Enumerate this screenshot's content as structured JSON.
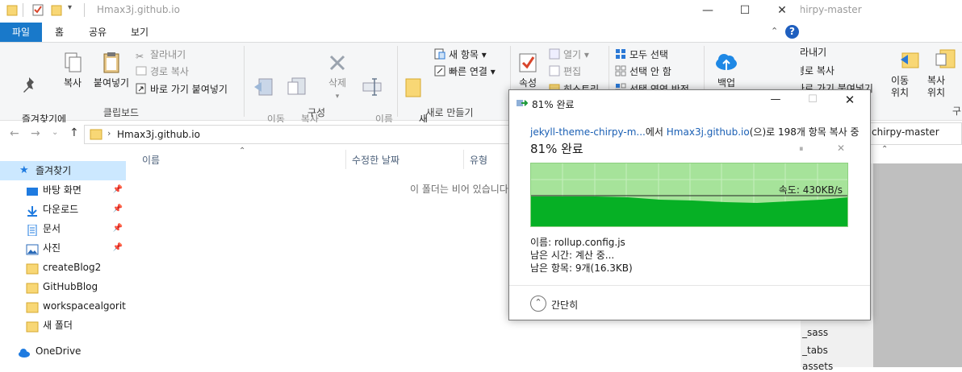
{
  "explorer": {
    "window_title": "Hmax3j.github.io",
    "tabs": [
      "파일",
      "홈",
      "공유",
      "보기"
    ],
    "ribbon": {
      "clipboard": {
        "pin": "즐겨찾기에\n고정",
        "copy": "복사",
        "paste": "붙여넣기",
        "cut": "잘라내기",
        "copy_path": "경로 복사",
        "paste_shortcut": "바로 가기 붙여넣기",
        "label": "클립보드"
      },
      "organize": {
        "move": "이동\n위치",
        "copy_to": "복사\n위치",
        "delete": "삭제",
        "rename": "이름\n바꾸기",
        "label": "구성"
      },
      "new": {
        "new_folder": "새\n폴더",
        "new_item": "새 항목",
        "easy_access": "빠른 연결",
        "label": "새로 만들기"
      },
      "open": {
        "properties": "속성",
        "open": "열기",
        "edit": "편집",
        "history": "히스토리"
      },
      "select": {
        "select_all": "모두 선택",
        "select_none": "선택 안 함",
        "invert": "선택 영역 반전"
      },
      "backup": "백업"
    },
    "address": {
      "path_item": "Hmax3j.github.io"
    },
    "nav": {
      "quick_access": "즐겨찾기",
      "items": [
        {
          "label": "바탕 화면",
          "pinned": true
        },
        {
          "label": "다운로드",
          "pinned": true
        },
        {
          "label": "문서",
          "pinned": true
        },
        {
          "label": "사진",
          "pinned": true
        },
        {
          "label": "createBlog2",
          "pinned": false
        },
        {
          "label": "GitHubBlog",
          "pinned": false
        },
        {
          "label": "workspacealgorithm",
          "pinned": false
        },
        {
          "label": "새 폴더",
          "pinned": false
        }
      ],
      "onedrive": "OneDrive"
    },
    "columns": [
      "이름",
      "수정한 날짜",
      "유형"
    ],
    "empty_message": "이 폴더는 비어 있습니다."
  },
  "right_window": {
    "title": "chirpy-master",
    "copy_path": "경로 복사",
    "paste_shortcut": "바로 가기 붙여넣기",
    "move": "이동\n위치",
    "copy_to": "복사\n위치",
    "group_label_partial": "구",
    "address": "chirpy-master",
    "files": [
      "_sass",
      "_tabs",
      "assets"
    ]
  },
  "dialog": {
    "title": "81% 완료",
    "src_link": "jekyll-theme-chirpy-m...",
    "from_text": "에서 ",
    "dst_link": "Hmax3j.github.io",
    "to_text": "(으)로 198개 항목 복사 중",
    "progress_text": "81% 완료",
    "progress_percent": 81,
    "speed": "속도: 430KB/s",
    "name_label": "이름: rollup.config.js",
    "time_label": "남은 시간: 계산 중...",
    "items_label": "남은 항목: 9개(16.3KB)",
    "less_details": "간단히",
    "colors": {
      "chart_bg": "#a6e39a",
      "chart_fill": "#06b025",
      "link": "#1a5fb4"
    }
  }
}
